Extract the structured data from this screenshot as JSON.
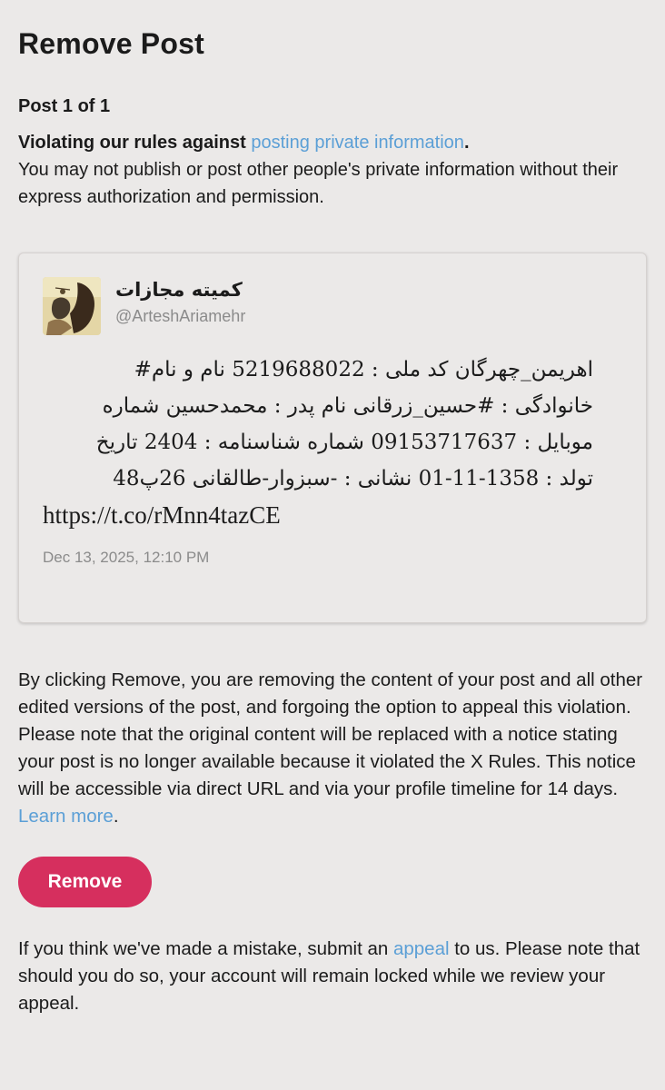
{
  "header": {
    "title": "Remove Post",
    "post_count": "Post 1 of 1"
  },
  "violation": {
    "headline_prefix": "Violating our rules against ",
    "rule_link": "posting private information",
    "headline_suffix": ".",
    "description": "You may not publish or post other people's private information without their express authorization and permission."
  },
  "post": {
    "display_name": "کمیته مجازات",
    "handle": "@ArteshAriamehr",
    "text_lines": [
      "اهریمن_چهرگان کد ملی : 5219688022 نام و نام#",
      "خانوادگی : #حسین_زرقانی نام پدر : محمدحسین شماره",
      "موبایل : 09153717637 شماره شناسنامه : 2404 تاریخ",
      "تولد : 1358-11-01 نشانی : -سبزوار-طالقانی 26پ48"
    ],
    "url": "https://t.co/rMnn4tazCE",
    "timestamp": "Dec 13, 2025, 12:10 PM",
    "avatar_icon": "profile-avatar-image"
  },
  "disclaimer": {
    "text": "By clicking Remove, you are removing the content of your post and all other edited versions of the post, and forgoing the option to appeal this violation. Please note that the original content will be replaced with a notice stating your post is no longer available because it violated the X Rules. This notice will be accessible via direct URL and via your profile timeline for 14 days. ",
    "learn_more": "Learn more",
    "end": "."
  },
  "actions": {
    "remove_label": "Remove"
  },
  "appeal": {
    "prefix": "If you think we've made a mistake, submit an ",
    "link": "appeal",
    "suffix": " to us. Please note that should you do so, your account will remain locked while we review your appeal."
  },
  "colors": {
    "background": "#ebe9e8",
    "link": "#5b9fd6",
    "remove_button": "#d62f5e",
    "muted_text": "#8b8b8b"
  }
}
